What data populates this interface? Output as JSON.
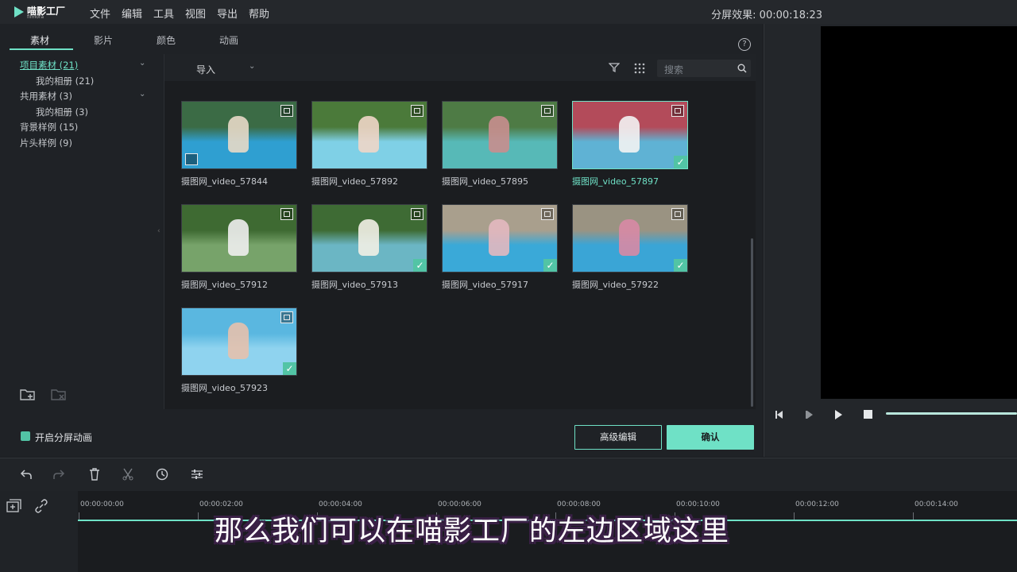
{
  "app": {
    "logo_name": "喵影工厂",
    "logo_sub": "filmora"
  },
  "menu": [
    "文件",
    "编辑",
    "工具",
    "视图",
    "导出",
    "帮助"
  ],
  "split_effect": "分屏效果: 00:00:18:23",
  "tabs": [
    "素材",
    "影片",
    "颜色",
    "动画"
  ],
  "tree": [
    {
      "label": "项目素材 (21)",
      "level": 0,
      "active": true,
      "chevron": true
    },
    {
      "label": "我的相册 (21)",
      "level": 1
    },
    {
      "label": "共用素材 (3)",
      "level": 0,
      "chevron": true
    },
    {
      "label": "我的相册 (3)",
      "level": 1
    },
    {
      "label": "背景样例 (15)",
      "level": 0
    },
    {
      "label": "片头样例 (9)",
      "level": 0
    }
  ],
  "toolbar": {
    "import": "导入",
    "search_placeholder": "搜索"
  },
  "clips": [
    {
      "label": "摄图网_video_57844",
      "checked": false,
      "selected": false,
      "scene": "pool-couple",
      "extra_icon": true
    },
    {
      "label": "摄图网_video_57892",
      "checked": false,
      "selected": false,
      "scene": "pool-edge"
    },
    {
      "label": "摄图网_video_57895",
      "checked": false,
      "selected": false,
      "scene": "pool-wade"
    },
    {
      "label": "摄图网_video_57897",
      "checked": true,
      "selected": true,
      "scene": "pool-slide"
    },
    {
      "label": "摄图网_video_57912",
      "checked": false,
      "selected": false,
      "scene": "garden-rock"
    },
    {
      "label": "摄图网_video_57913",
      "checked": true,
      "selected": false,
      "scene": "garden-drink"
    },
    {
      "label": "摄图网_video_57917",
      "checked": true,
      "selected": false,
      "scene": "pool-sit"
    },
    {
      "label": "摄图网_video_57922",
      "checked": true,
      "selected": false,
      "scene": "pool-sit2"
    },
    {
      "label": "摄图网_video_57923",
      "checked": true,
      "selected": false,
      "scene": "water-closeup"
    }
  ],
  "split_animation_label": "开启分屏动画",
  "buttons": {
    "advanced": "高级编辑",
    "confirm": "确认"
  },
  "timeline": {
    "ticks": [
      "00:00:00:00",
      "00:00:02:00",
      "00:00:04:00",
      "00:00:06:00",
      "00:00:08:00",
      "00:00:10:00",
      "00:00:12:00",
      "00:00:14:00"
    ]
  },
  "subtitle": "那么我们可以在喵影工厂的左边区域这里",
  "colors": {
    "accent": "#6fe1c6",
    "check": "#52c4a5"
  }
}
